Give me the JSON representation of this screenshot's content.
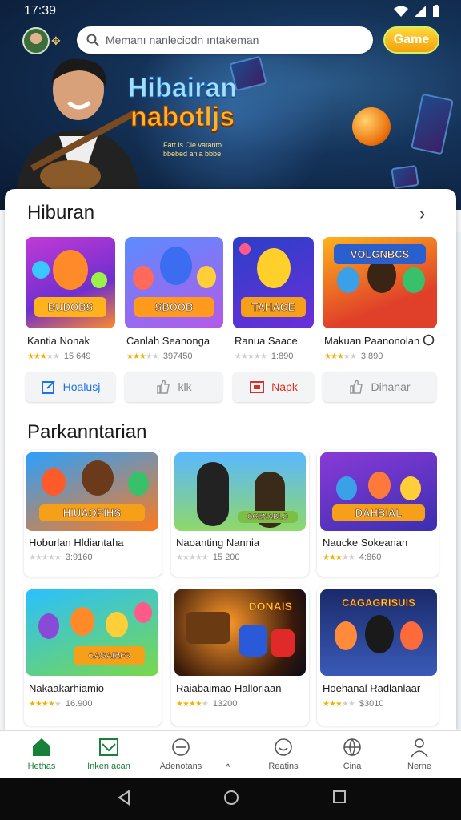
{
  "status": {
    "time": "17:39"
  },
  "search": {
    "placeholder": "Memanı nanleciodn ıntakeman"
  },
  "header": {
    "game_button": "Game"
  },
  "hero": {
    "title_line1": "Hibairan",
    "title_line2": "nabotljs",
    "subtitle": "Fatr is Cle vatanto bbebed anla bbbe"
  },
  "section1": {
    "title": "Hiburan",
    "games": [
      {
        "name": "Kantia Nonak",
        "rating": 3,
        "count": "15 649",
        "art": "BUDOBS"
      },
      {
        "name": "Canlah Seanonga",
        "rating": 3,
        "count": "397450",
        "art": "SBOOB"
      },
      {
        "name": "Ranua Saace",
        "rating": 0,
        "count": "1:890",
        "art": "TAHAGE"
      },
      {
        "name": "Makuan Paanonolan",
        "rating": 3,
        "count": "3:890",
        "art": "VOLGNBCS"
      }
    ],
    "actions": [
      {
        "label": "Hoalusj",
        "icon": "edit-icon"
      },
      {
        "label": "klk",
        "icon": "thumbs-up-icon"
      },
      {
        "label": "Napk",
        "icon": "media-icon"
      },
      {
        "label": "Dihanar",
        "icon": "thumbs-up-icon"
      }
    ]
  },
  "section2": {
    "title": "Parkanntarian",
    "games": [
      {
        "name": "Hoburlan Hldiantaha",
        "rating": 0,
        "count": "3:9160",
        "art": "HIUAOPIHS"
      },
      {
        "name": "Naoanting Nannia",
        "rating": 0,
        "count": "15 200",
        "art": "CCENABLO"
      },
      {
        "name": "Naucke Sokeanan",
        "rating": 3,
        "count": "4:860",
        "art": "DAHBIAL"
      },
      {
        "name": "Nakaakarhiamio",
        "rating": 4,
        "count": "16.900",
        "art": "CAGAIRFS"
      },
      {
        "name": "Raiabaimao Hallorlaan",
        "rating": 4,
        "count": "13200",
        "art": "DONAIS"
      },
      {
        "name": "Hoehanal Radlanlaar",
        "rating": 3,
        "count": "$3010",
        "art": "CAGAGRISUIS"
      }
    ]
  },
  "nav": [
    {
      "label": "Hethas",
      "icon": "home-icon",
      "active": true
    },
    {
      "label": "Inkenıacan",
      "icon": "image-box-icon",
      "active": false
    },
    {
      "label": "Adenotans",
      "icon": "timer-icon",
      "active": false
    },
    {
      "label": "Reatins",
      "icon": "smile-icon",
      "active": false
    },
    {
      "label": "Cina",
      "icon": "globe-icon",
      "active": false
    },
    {
      "label": "Nerne",
      "icon": "person-icon",
      "active": false
    }
  ],
  "colors": {
    "accent_green": "#188038",
    "accent_red": "#d93025",
    "accent_blue": "#1a73e8",
    "hero_bg": "#143258"
  }
}
